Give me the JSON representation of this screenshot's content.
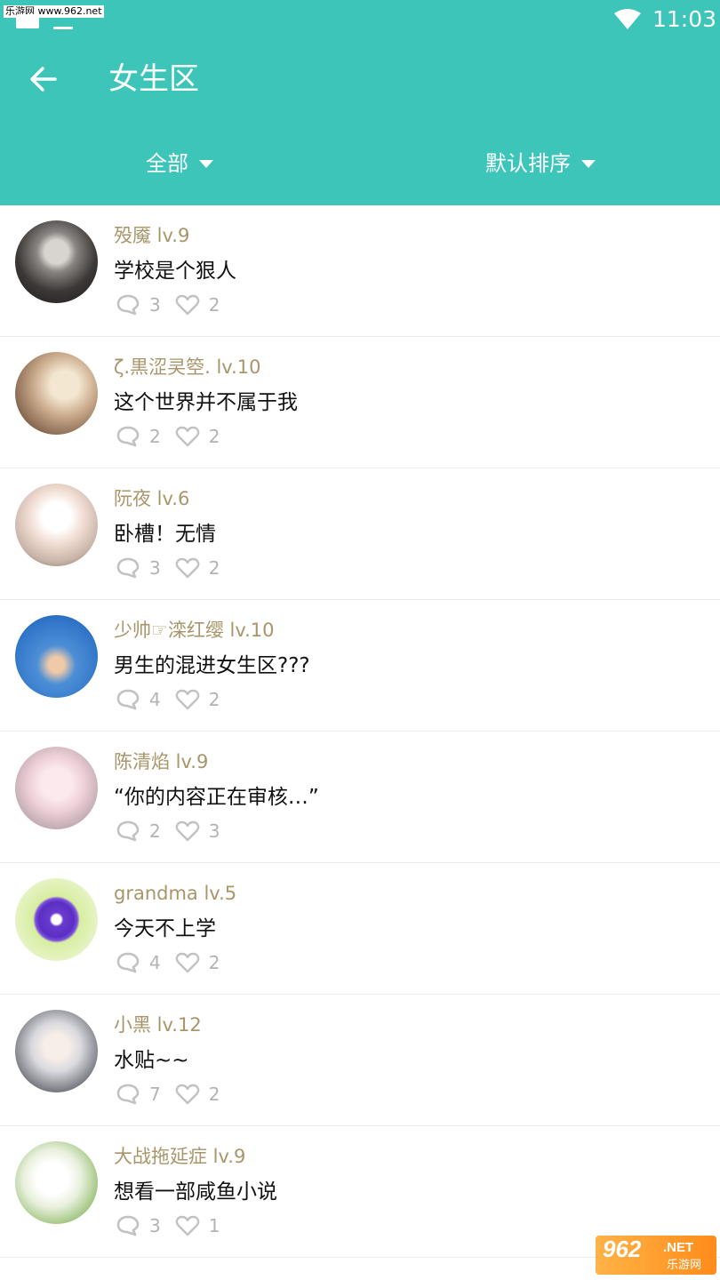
{
  "status_bar": {
    "watermark": "乐游网 www.962.net",
    "time": "11:03"
  },
  "header": {
    "title": "女生区",
    "back_icon": "arrow-left-icon",
    "filters": [
      {
        "label": "全部",
        "icon": "caret-down-icon"
      },
      {
        "label": "默认排序",
        "icon": "caret-down-icon"
      }
    ]
  },
  "colors": {
    "accent": "#3cc5b8",
    "username": "#a8966a",
    "stat_text": "#b3b3b3"
  },
  "posts": [
    {
      "user": "殁魇 lv.9",
      "text": "学校是个狠人",
      "comments": "3",
      "likes": "2"
    },
    {
      "user": "ζ.黒涩㚑箜. lv.10",
      "text": "这个世界并不属于我",
      "comments": "2",
      "likes": "2"
    },
    {
      "user": "阮夜 lv.6",
      "text": "卧槽！无情",
      "comments": "3",
      "likes": "2"
    },
    {
      "user": "少帅☞滦红缨 lv.10",
      "text": "男生的混进女生区???",
      "comments": "4",
      "likes": "2"
    },
    {
      "user": "陈清焰 lv.9",
      "text": "“你的内容正在审核…”",
      "comments": "2",
      "likes": "3"
    },
    {
      "user": "grandma lv.5",
      "text": "今天不上学",
      "comments": "4",
      "likes": "2"
    },
    {
      "user": "小黑 lv.12",
      "text": "水贴~~",
      "comments": "7",
      "likes": "2"
    },
    {
      "user": "大战拖延症 lv.9",
      "text": "想看一部咸鱼小说",
      "comments": "3",
      "likes": "1"
    }
  ],
  "logo": {
    "main": "962",
    "net": ".NET",
    "sub": "乐游网"
  }
}
